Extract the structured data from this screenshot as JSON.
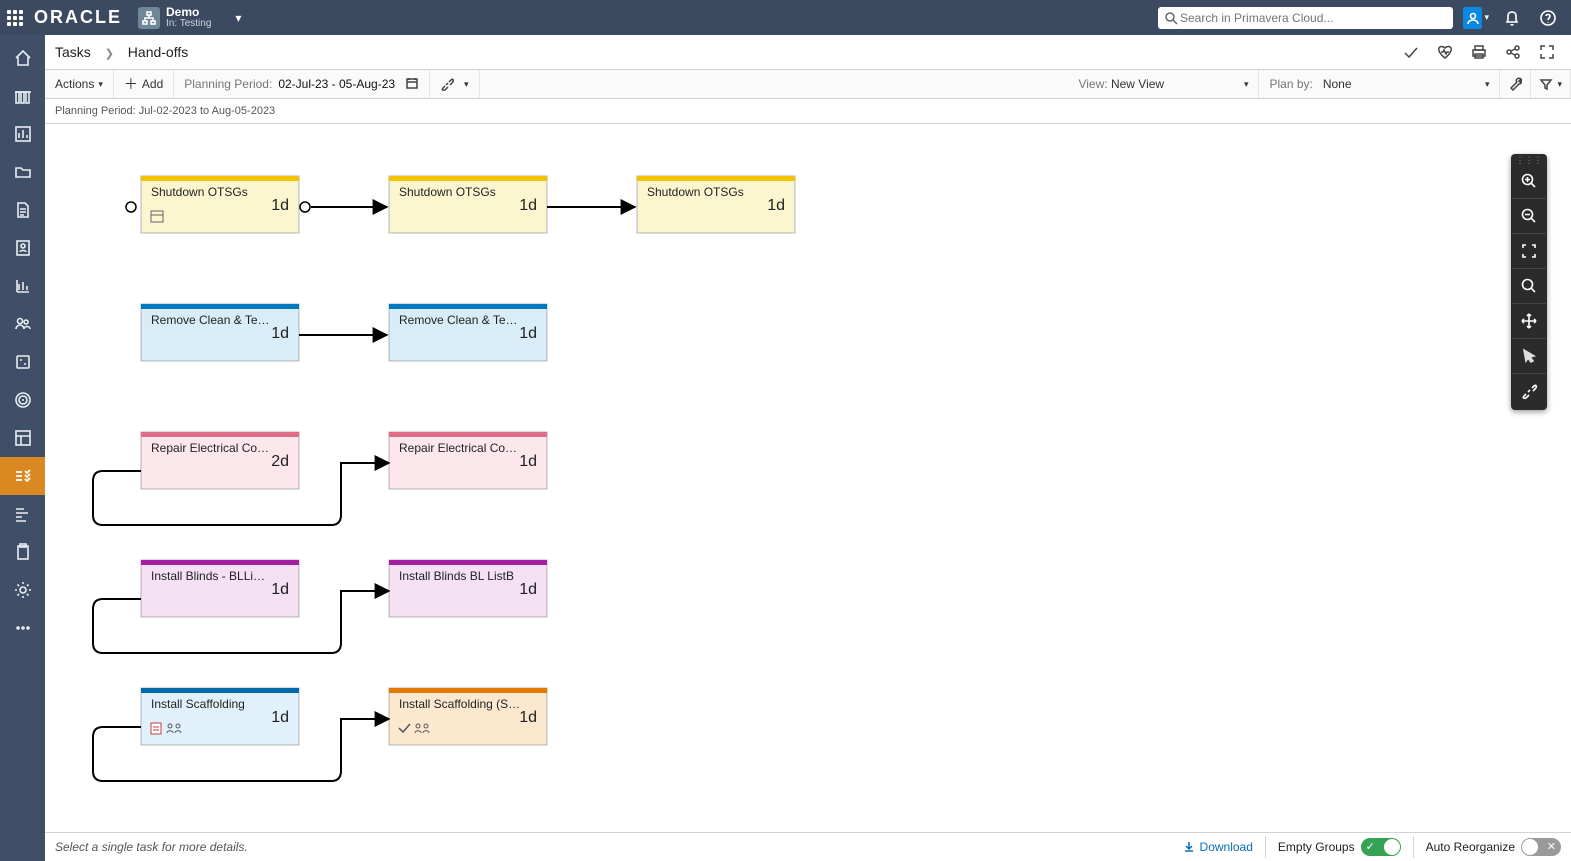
{
  "header": {
    "brand": "ORACLE",
    "project_name": "Demo",
    "project_status": "In: Testing",
    "search_placeholder": "Search in Primavera Cloud..."
  },
  "breadcrumb": {
    "parent": "Tasks",
    "current": "Hand-offs"
  },
  "toolbar": {
    "actions_label": "Actions",
    "add_label": "Add",
    "planning_period_label": "Planning Period:",
    "planning_period_value": "02-Jul-23 - 05-Aug-23",
    "view_label": "View:",
    "view_value": "New View",
    "plan_by_label": "Plan by:",
    "plan_by_value": "None"
  },
  "info": {
    "planning_period_full_label": "Planning Period:",
    "planning_period_full_value": "Jul-02-2023 to Aug-05-2023"
  },
  "tasks": {
    "r1": [
      {
        "title": "Shutdown OTSGs",
        "duration": "1d",
        "top": "yellow",
        "has_calendar": true
      },
      {
        "title": "Shutdown OTSGs",
        "duration": "1d",
        "top": "yellow"
      },
      {
        "title": "Shutdown OTSGs",
        "duration": "1d",
        "top": "yellow"
      }
    ],
    "r2": [
      {
        "title": "Remove Clean & Te…",
        "duration": "1d",
        "top": "blue"
      },
      {
        "title": "Remove Clean & Te…",
        "duration": "1d",
        "top": "blue"
      }
    ],
    "r3": [
      {
        "title": "Repair Electrical Co…",
        "duration": "2d",
        "top": "pink"
      },
      {
        "title": "Repair Electrical Co…",
        "duration": "1d",
        "top": "pink"
      }
    ],
    "r4": [
      {
        "title": "Install Blinds - BLLi…",
        "duration": "1d",
        "top": "purple"
      },
      {
        "title": "Install Blinds  BL ListB",
        "duration": "1d",
        "top": "purple"
      }
    ],
    "r5": [
      {
        "title": "Install Scaffolding",
        "duration": "1d",
        "top": "darkblue",
        "has_doc": true,
        "has_people": true
      },
      {
        "title": "Install Scaffolding (S…",
        "duration": "1d",
        "top": "orange",
        "has_check": true,
        "has_people": true
      }
    ]
  },
  "status": {
    "hint": "Select a single task for more details.",
    "download_label": "Download",
    "empty_groups_label": "Empty Groups",
    "auto_reorganize_label": "Auto Reorganize"
  },
  "colors": {
    "yellow": "#f4c403",
    "yellow_fill": "#fbf6cf",
    "blue": "#0079c0",
    "blue_fill": "#d9edf8",
    "pink": "#e06e88",
    "pink_fill": "#fce7ec",
    "purple": "#a31ea1",
    "purple_fill": "#f4e1f4",
    "orange": "#e37900",
    "orange_fill": "#fce8cf",
    "darkblue": "#006aab",
    "darkblue_fill": "#e1f1fb"
  }
}
